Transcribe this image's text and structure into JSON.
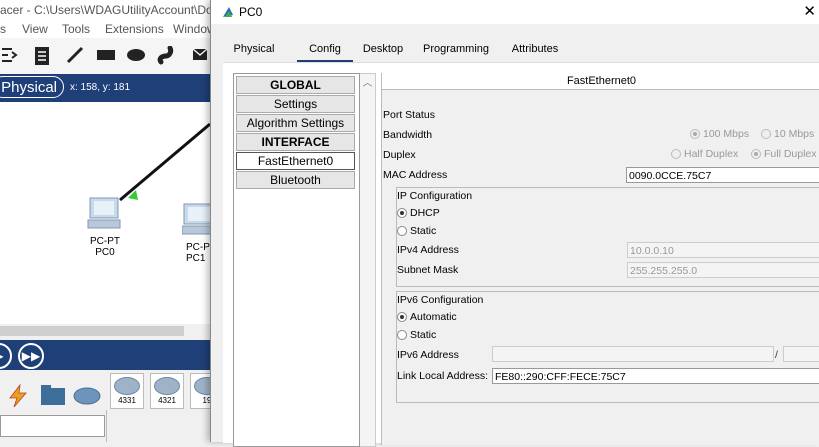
{
  "main_window": {
    "title": "acer - C:\\Users\\WDAGUtilityAccount\\Do",
    "menu": [
      "s",
      "View",
      "Tools",
      "Extensions",
      "Window"
    ],
    "physical_button": "Physical",
    "coords": "x: 158, y: 181",
    "devices": [
      {
        "type": "PC-PT",
        "name": "PC0"
      },
      {
        "type": "PC-P",
        "name": "PC1"
      }
    ],
    "device_tiles": [
      "4331",
      "4321",
      "19"
    ]
  },
  "pc_window": {
    "title": "PC0",
    "tabs": [
      "Physical",
      "Config",
      "Desktop",
      "Programming",
      "Attributes"
    ],
    "active_tab": "Config",
    "nav": {
      "global_header": "GLOBAL",
      "settings": "Settings",
      "algorithm_settings": "Algorithm Settings",
      "interface_header": "INTERFACE",
      "fastethernet": "FastEthernet0",
      "bluetooth": "Bluetooth"
    },
    "content": {
      "header": "FastEthernet0",
      "port_status_label": "Port Status",
      "bandwidth_label": "Bandwidth",
      "bandwidth_100": "100 Mbps",
      "bandwidth_10": "10 Mbps",
      "duplex_label": "Duplex",
      "half_duplex": "Half Duplex",
      "full_duplex": "Full Duplex",
      "mac_label": "MAC Address",
      "mac_value": "0090.0CCE.75C7",
      "ip_config_title": "IP Configuration",
      "dhcp": "DHCP",
      "static": "Static",
      "ipv4_label": "IPv4 Address",
      "ipv4_value": "10.0.0.10",
      "subnet_label": "Subnet Mask",
      "subnet_value": "255.255.255.0",
      "ipv6_config_title": "IPv6 Configuration",
      "automatic": "Automatic",
      "static6": "Static",
      "ipv6_label": "IPv6 Address",
      "ipv6_value": "",
      "ipv6_sep": "/",
      "link_local_label": "Link Local Address:",
      "link_local_value": "FE80::290:CFF:FECE:75C7"
    }
  }
}
